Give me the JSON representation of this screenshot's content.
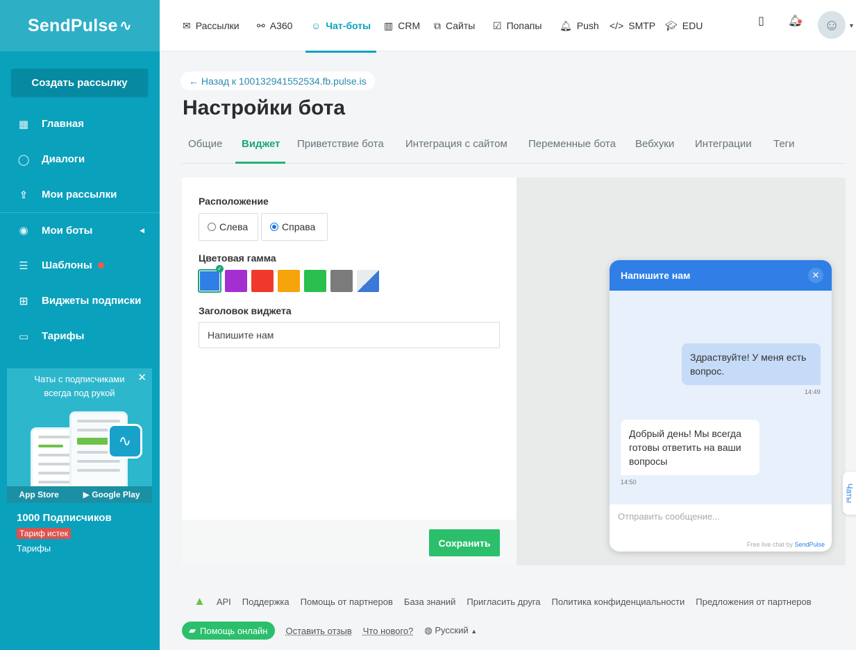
{
  "app": {
    "logo": "SendPulse",
    "logo_mark": "∿"
  },
  "sidebar": {
    "create_button": "Создать рассылку",
    "items": [
      {
        "label": "Главная",
        "icon": "dashboard-icon"
      },
      {
        "label": "Диалоги",
        "icon": "chat-icon"
      },
      {
        "label": "Мои рассылки",
        "icon": "mailing-icon"
      },
      {
        "label": "Мои боты",
        "icon": "bot-icon"
      },
      {
        "label": "Шаблоны",
        "icon": "templates-icon"
      },
      {
        "label": "Виджеты подписки",
        "icon": "widget-icon"
      },
      {
        "label": "Тарифы",
        "icon": "wallet-icon"
      }
    ],
    "promo": {
      "text": "Чаты с подписчиками всегда под рукой",
      "app_store": "App Store",
      "google_play": "Google Play"
    },
    "plan": {
      "subscribers": "1000 Подписчиков",
      "status": "Тариф истек",
      "link": "Тарифы"
    }
  },
  "topnav": {
    "items": [
      {
        "label": "Рассылки",
        "icon": "mail-icon"
      },
      {
        "label": "A360",
        "icon": "automation-icon"
      },
      {
        "label": "Чат-боты",
        "icon": "chatbot-icon",
        "active": true
      },
      {
        "label": "CRM",
        "icon": "crm-icon"
      },
      {
        "label": "Сайты",
        "icon": "sites-icon"
      },
      {
        "label": "Попапы",
        "icon": "popup-icon"
      },
      {
        "label": "Push",
        "icon": "bell-icon"
      },
      {
        "label": "SMTP",
        "icon": "code-icon"
      },
      {
        "label": "EDU",
        "icon": "graduation-icon"
      }
    ]
  },
  "page": {
    "back_link": "← Назад к 100132941552534.fb.pulse.is",
    "title": "Настройки бота",
    "tabs": [
      "Общие",
      "Виджет",
      "Приветствие бота",
      "Интеграция с сайтом",
      "Переменные бота",
      "Вебхуки",
      "Интеграции",
      "Теги"
    ],
    "active_tab": "Виджет"
  },
  "settings": {
    "position_label": "Расположение",
    "position_left": "Слева",
    "position_right": "Справа",
    "position_selected": "Справа",
    "color_label": "Цветовая гамма",
    "colors": [
      "#2f7fe6",
      "#a42fd1",
      "#f0392b",
      "#f7a30c",
      "#2bbf4e",
      "#7b7b7b",
      "gradient-blue-white"
    ],
    "color_selected": "#2f7fe6",
    "widget_title_label": "Заголовок виджета",
    "widget_title_value": "Напишите нам",
    "save_button": "Сохранить"
  },
  "preview": {
    "header": "Напишите нам",
    "message_out": "Здраствуйте! У меня есть вопрос.",
    "time_out": "14:49",
    "message_in": "Добрый день! Мы всегда готовы ответить на ваши вопросы",
    "time_in": "14:50",
    "input_placeholder": "Отправить сообщение...",
    "powered_prefix": "Free live chat by",
    "powered_brand": "SendPulse",
    "chats_tab": "Чаты"
  },
  "footer": {
    "links": [
      "API",
      "Поддержка",
      "Помощь от партнеров",
      "База знаний",
      "Пригласить друга",
      "Политика конфиденциальности",
      "Предложения от партнеров"
    ],
    "help_button": "Помощь онлайн",
    "feedback": "Оставить отзыв",
    "whats_new": "Что нового?",
    "language": "Русский"
  }
}
